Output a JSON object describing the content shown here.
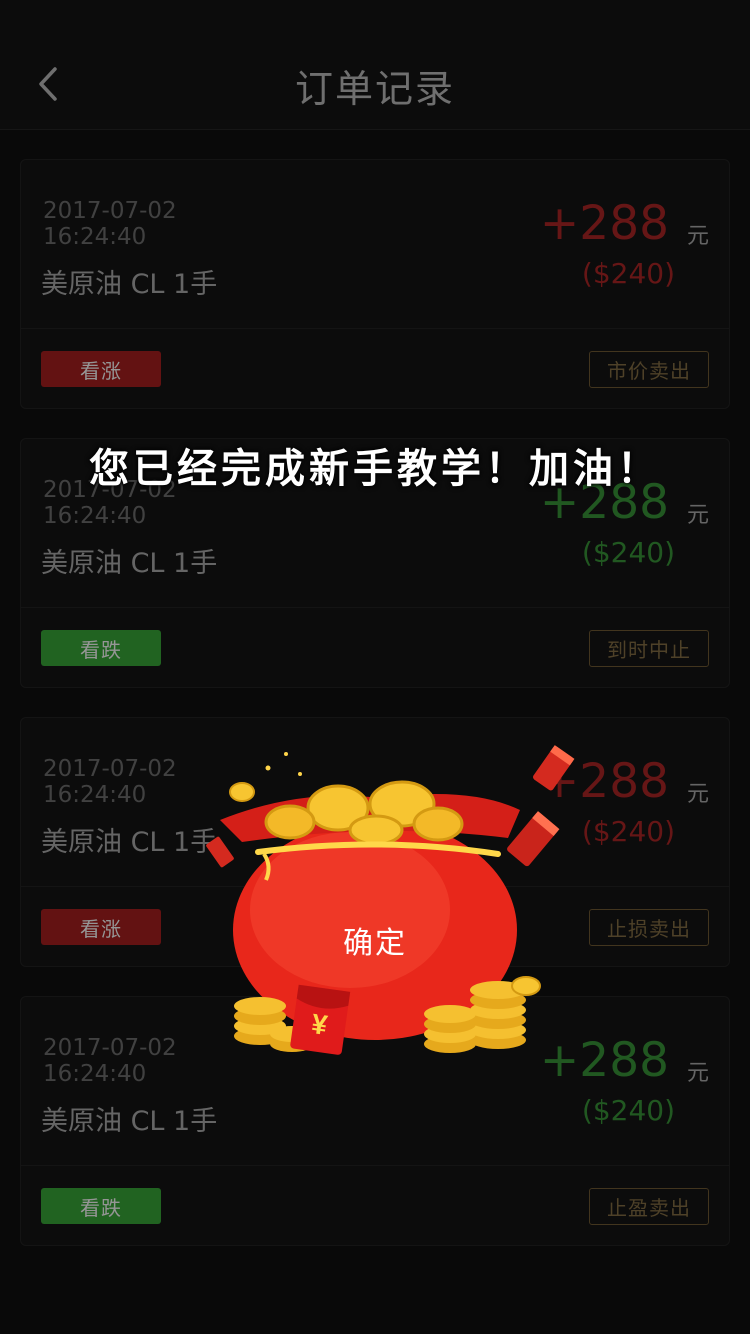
{
  "header": {
    "title": "订单记录"
  },
  "orders": [
    {
      "date": "2017-07-02",
      "time": "16:24:40",
      "product": "美原油 CL 1手",
      "amount": "+288",
      "unit": "元",
      "usd": "($240)",
      "direction_label": "看涨",
      "action_label": "市价卖出",
      "direction": "up"
    },
    {
      "date": "2017-07-02",
      "time": "16:24:40",
      "product": "美原油 CL 1手",
      "amount": "+288",
      "unit": "元",
      "usd": "($240)",
      "direction_label": "看跌",
      "action_label": "到时中止",
      "direction": "down"
    },
    {
      "date": "2017-07-02",
      "time": "16:24:40",
      "product": "美原油 CL 1手",
      "amount": "+288",
      "unit": "元",
      "usd": "($240)",
      "direction_label": "看涨",
      "action_label": "止损卖出",
      "direction": "up"
    },
    {
      "date": "2017-07-02",
      "time": "16:24:40",
      "product": "美原油 CL 1手",
      "amount": "+288",
      "unit": "元",
      "usd": "($240)",
      "direction_label": "看跌",
      "action_label": "止盈卖出",
      "direction": "down"
    }
  ],
  "overlay": {
    "message": "您已经完成新手教学！加油！",
    "confirm_label": "确定",
    "envelope_symbol": "¥"
  },
  "colors": {
    "up": "#8a1a1a",
    "down": "#2e8a2e",
    "action_border": "#5c4a2a"
  }
}
